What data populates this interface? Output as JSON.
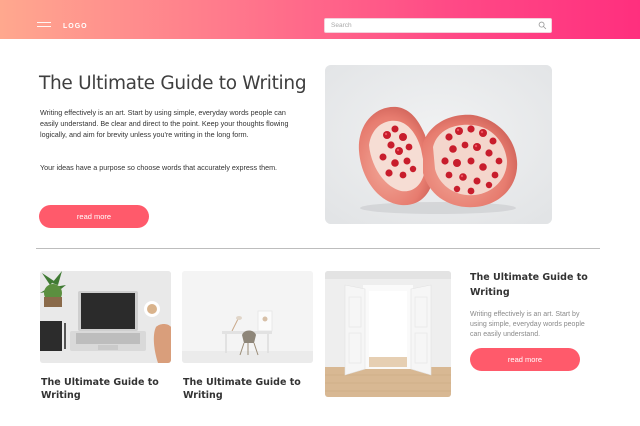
{
  "header": {
    "logo": "LOGO",
    "search_placeholder": "Search"
  },
  "hero": {
    "title": "The Ultimate Guide to Writing",
    "paragraph1": "Writing effectively is an art. Start by using simple, everyday words people can easily understand. Be clear and direct to the point. Keep your thoughts flowing logically, and aim for brevity unless you're writing in the long form.",
    "paragraph2": "Your ideas have a purpose so choose words that accurately express them.",
    "button_label": "read more"
  },
  "cards": [
    {
      "title": "The Ultimate Guide to Writing"
    },
    {
      "title": "The Ultimate Guide to Writing"
    }
  ],
  "feature": {
    "title": "The Ultimate Guide to Writing",
    "text": "Writing effectively is an art. Start by using simple, everyday words people can easily understand.",
    "button_label": "read more"
  },
  "colors": {
    "header_gradient_start": "#ffa88e",
    "header_gradient_end": "#ff2f7e",
    "button": "#ff5a6b"
  }
}
